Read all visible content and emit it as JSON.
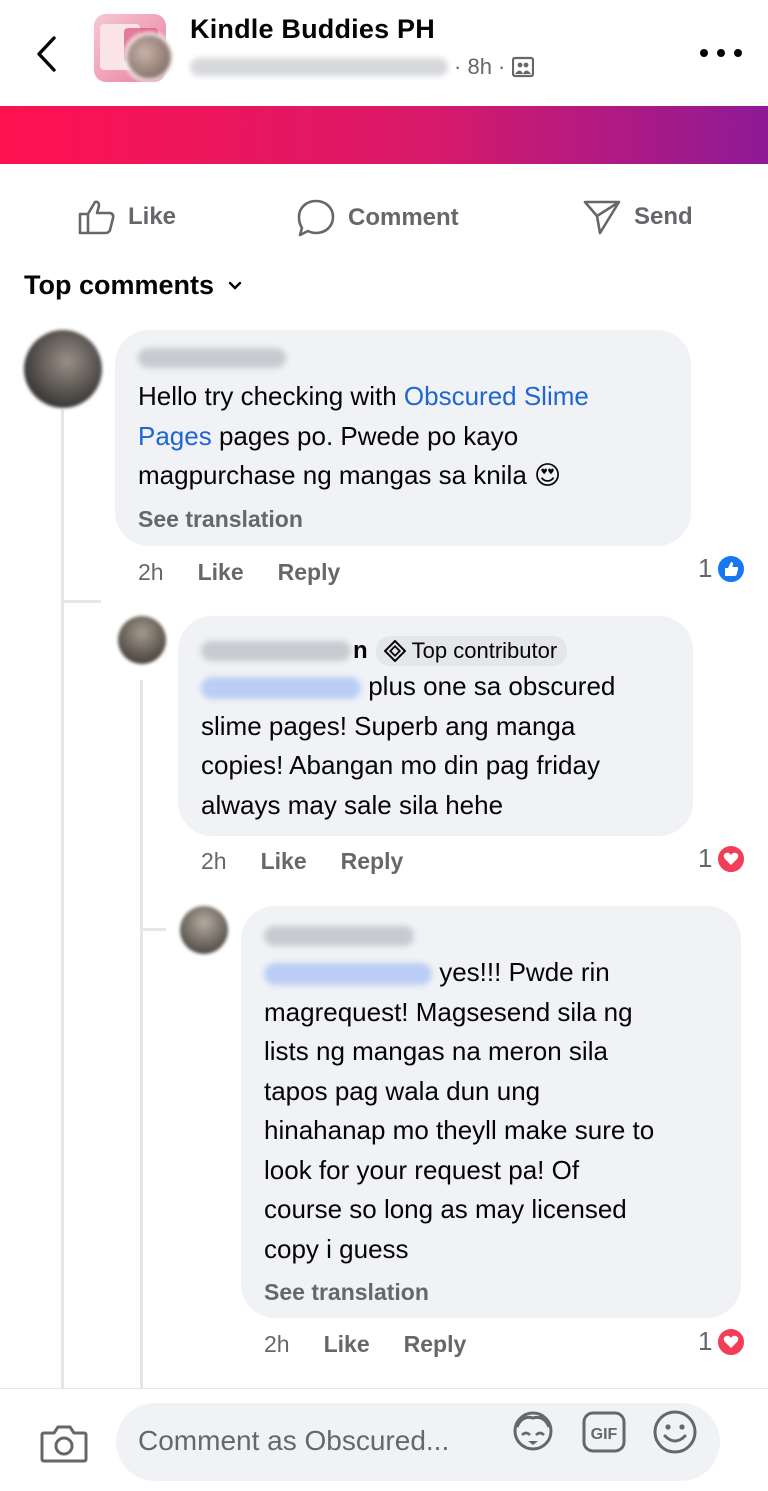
{
  "header": {
    "group_name": "Kindle Buddies PH",
    "post_time": "8h"
  },
  "actions": {
    "like": "Like",
    "comment": "Comment",
    "send": "Send"
  },
  "top_comments_label": "Top comments",
  "comments": [
    {
      "text_line1": "Hello try checking with ",
      "link": "Obscured Slime",
      "link2": "Pages",
      "text_line2_rest": "  pages po. Pwede po kayo",
      "text_line3": "magpurchase ng mangas sa knila ",
      "emoji": "😍",
      "see_translation": "See translation",
      "time": "2h",
      "like": "Like",
      "reply": "Reply",
      "reaction_count": "1"
    },
    {
      "badge": "Top contributor",
      "text_line1": " plus one sa obscured",
      "text_line2": "slime pages! Superb ang manga",
      "text_line3": "copies! Abangan mo din pag friday",
      "text_line4": "always may sale sila hehe",
      "time": "2h",
      "like": "Like",
      "reply": "Reply",
      "reaction_count": "1"
    },
    {
      "text_line1": " yes!!! Pwde rin",
      "text_line2": "magrequest! Magsesend sila ng",
      "text_line3": "lists ng mangas na meron sila",
      "text_line4": "tapos pag wala dun ung",
      "text_line5": "hinahanap mo theyll make sure to",
      "text_line6": "look for your request pa! Of",
      "text_line7": "course so long as may licensed",
      "text_line8": "copy i guess",
      "see_translation": "See translation",
      "time": "2h",
      "like": "Like",
      "reply": "Reply",
      "reaction_count": "1"
    }
  ],
  "composer": {
    "placeholder": "Comment as Obscured..."
  },
  "colors": {
    "like_blue": "#1877f2",
    "love_red": "#f33e58",
    "link_blue": "#1f66d2",
    "strip_start": "#ff1150",
    "strip_end": "#8e1a96"
  },
  "icons": [
    "back-arrow-icon",
    "more-icon",
    "like-icon",
    "comment-icon",
    "send-icon",
    "chevron-down-icon",
    "top-contributor-icon",
    "camera-icon",
    "avatar-sticker-icon",
    "gif-icon",
    "emoji-icon"
  ]
}
